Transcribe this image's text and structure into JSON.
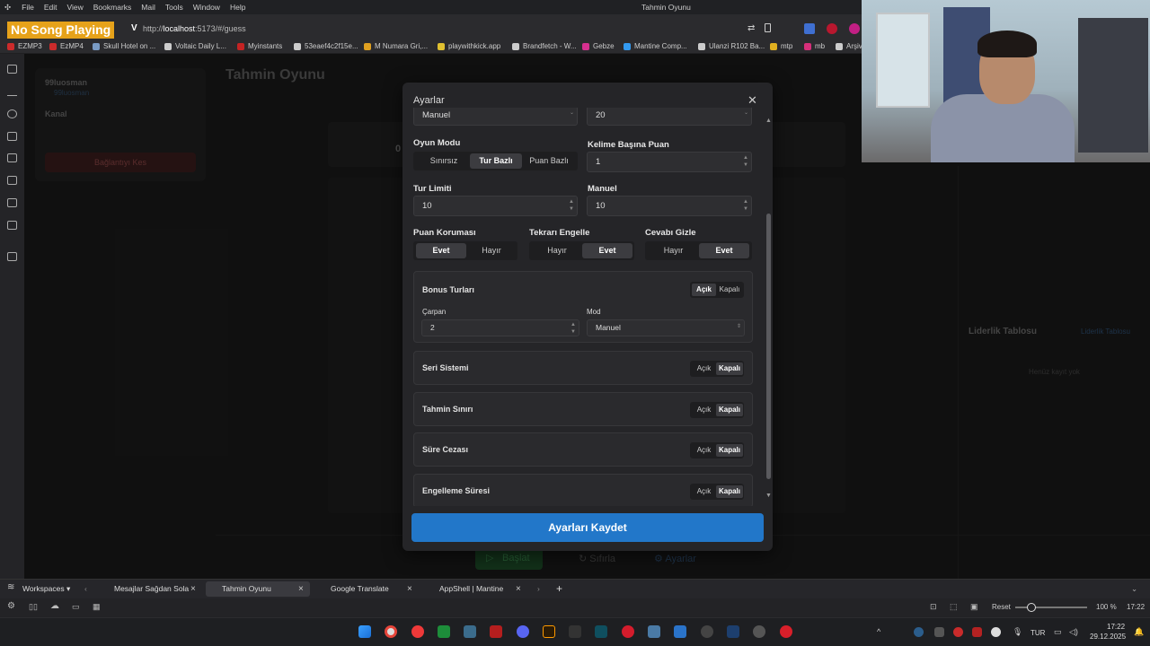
{
  "browser": {
    "menu": [
      "File",
      "Edit",
      "View",
      "Bookmarks",
      "Mail",
      "Tools",
      "Window",
      "Help"
    ],
    "window_title": "Tahmin Oyunu",
    "song_badge": "No Song Playing",
    "url_prefix": "http://",
    "url_host": "localhost",
    "url_rest": ":5173/#/guess",
    "bookmarks": [
      {
        "label": "EZMP3",
        "color": "#cc2b2b"
      },
      {
        "label": "EzMP4",
        "color": "#cc2b2b"
      },
      {
        "label": "Skull Hotel on ...",
        "color": "#7a9bc4"
      },
      {
        "label": "Voltaic Daily L...",
        "color": "#cccccc"
      },
      {
        "label": "Myinstants",
        "color": "#c42323"
      },
      {
        "label": "53eaef4c2f15e...",
        "color": "#cccccc"
      },
      {
        "label": "M Numara Gri,...",
        "color": "#e0a020"
      },
      {
        "label": "playwithkick.app",
        "color": "#e0c030"
      },
      {
        "label": "Brandfetch - W...",
        "color": "#cccccc"
      },
      {
        "label": "Gebze",
        "color": "#d6308f"
      },
      {
        "label": "Mantine Comp...",
        "color": "#339af0"
      },
      {
        "label": "Ulanzi R102 Ba...",
        "color": "#cccccc"
      },
      {
        "label": "mtp",
        "color": "#e0b020"
      },
      {
        "label": "mb",
        "color": "#d62f7a"
      },
      {
        "label": "Arşiv",
        "color": "#cccccc"
      }
    ]
  },
  "app": {
    "user_name": "99luosman",
    "user_handle": "99luosman",
    "kanal_label": "Kanal",
    "disconnect": "Bağlantıyı Kes",
    "game_title": "Tahmin Oyunu",
    "score_digit": "0",
    "leaderboard_title": "Liderlik Tablosu",
    "leaderboard_link": "Liderlik Tablosu",
    "no_records": "Henüz kayıt yok",
    "start": "Başlat",
    "reset": "Sıfırla",
    "settings": "Ayarlar"
  },
  "modal": {
    "title": "Ayarlar",
    "close_icon": "close-icon",
    "partial_top_left": "Manuel",
    "partial_top_right": "20",
    "game_mode_label": "Oyun Modu",
    "game_mode_options": [
      "Sınırsız",
      "Tur Bazlı",
      "Puan Bazlı"
    ],
    "game_mode_selected": "Tur Bazlı",
    "points_per_word_label": "Kelime Başına Puan",
    "points_per_word_value": "1",
    "round_limit_label": "Tur Limiti",
    "round_limit_value": "10",
    "manual_label": "Manuel",
    "manual_value": "10",
    "toggles3": [
      {
        "label": "Puan Koruması",
        "options": [
          "Evet",
          "Hayır"
        ],
        "selected": "Evet"
      },
      {
        "label": "Tekrarı Engelle",
        "options": [
          "Hayır",
          "Evet"
        ],
        "selected": "Evet"
      },
      {
        "label": "Cevabı Gizle",
        "options": [
          "Hayır",
          "Evet"
        ],
        "selected": "Evet"
      }
    ],
    "bonus": {
      "label": "Bonus Turları",
      "on": "Açık",
      "off": "Kapalı",
      "selected": "Açık",
      "multiplier_label": "Çarpan",
      "multiplier_value": "2",
      "mode_label": "Mod",
      "mode_value": "Manuel"
    },
    "feature_cards": [
      {
        "label": "Seri Sistemi",
        "on": "Açık",
        "off": "Kapalı",
        "selected": "Kapalı"
      },
      {
        "label": "Tahmin Sınırı",
        "on": "Açık",
        "off": "Kapalı",
        "selected": "Kapalı"
      },
      {
        "label": "Süre Cezası",
        "on": "Açık",
        "off": "Kapalı",
        "selected": "Kapalı"
      },
      {
        "label": "Engelleme Süresi",
        "on": "Açık",
        "off": "Kapalı",
        "selected": "Kapalı"
      }
    ],
    "save": "Ayarları Kaydet"
  },
  "tabs": {
    "workspaces": "Workspaces",
    "items": [
      {
        "label": "Mesajlar Sağdan Sola",
        "active": false
      },
      {
        "label": "Tahmin Oyunu",
        "active": true
      },
      {
        "label": "Google Translate",
        "active": false
      },
      {
        "label": "AppShell | Mantine",
        "active": false
      }
    ]
  },
  "statusbar": {
    "reset": "Reset",
    "zoom": "100 %",
    "time": "17:22"
  },
  "taskbar": {
    "lang": "TUR",
    "clock_time": "17:22",
    "clock_date": "29.12.2025"
  }
}
